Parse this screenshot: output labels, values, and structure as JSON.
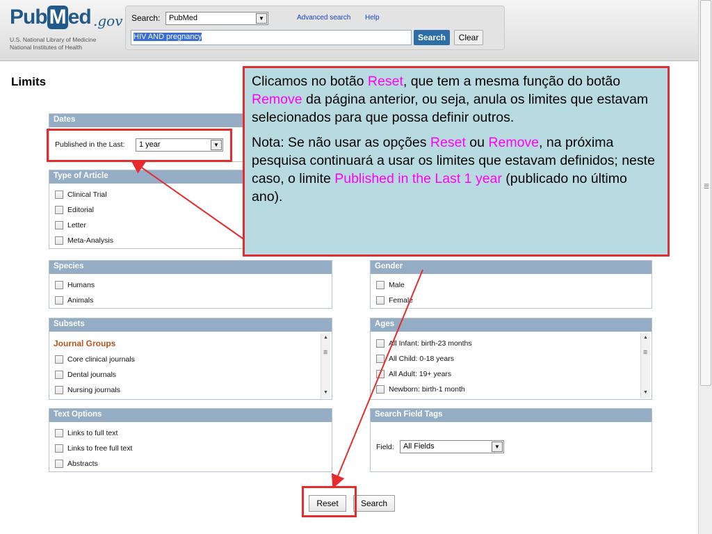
{
  "header": {
    "logo_pub": "Pub",
    "logo_m": "M",
    "logo_ed": "ed",
    "logo_gov": ".gov",
    "logo_sub1": "U.S. National Library of Medicine",
    "logo_sub2": "National Institutes of Health",
    "search_label": "Search:",
    "database": "PubMed",
    "advanced_link": "Advanced search",
    "help_link": "Help",
    "query": "HIV AND pregnancy",
    "search_button": "Search",
    "clear_button": "Clear"
  },
  "page_title": "Limits",
  "dates": {
    "heading": "Dates",
    "published_label": "Published in the Last:",
    "published_value": "1 year"
  },
  "type_of_article": {
    "heading": "Type of Article",
    "items": [
      "Clinical Trial",
      "Editorial",
      "Letter",
      "Meta-Analysis"
    ]
  },
  "species": {
    "heading": "Species",
    "items": [
      "Humans",
      "Animals"
    ]
  },
  "gender": {
    "heading": "Gender",
    "items": [
      "Male",
      "Female"
    ]
  },
  "subsets": {
    "heading": "Subsets",
    "group_title": "Journal Groups",
    "items": [
      "Core clinical journals",
      "Dental journals",
      "Nursing journals"
    ]
  },
  "ages": {
    "heading": "Ages",
    "items": [
      "All Infant: birth-23 months",
      "All Child: 0-18 years",
      "All Adult: 19+ years",
      "Newborn: birth-1 month"
    ]
  },
  "text_options": {
    "heading": "Text Options",
    "items": [
      "Links to full text",
      "Links to free full text",
      "Abstracts"
    ]
  },
  "search_field_tags": {
    "heading": "Search Field Tags",
    "field_label": "Field:",
    "field_value": "All Fields"
  },
  "bottom": {
    "reset_button": "Reset",
    "search_button": "Search"
  },
  "callout": {
    "p1_a": "Clicamos no botão ",
    "p1_reset": "Reset",
    "p1_b": ", que tem a mesma função do botão ",
    "p1_remove": "Remove",
    "p1_c": " da página anterior, ou seja, anula os limites que estavam selecionados para que possa definir outros.",
    "p2_a": "Nota: Se não usar as opções ",
    "p2_reset": "Reset",
    "p2_b": " ou ",
    "p2_remove": "Remove",
    "p2_c": ", na próxima pesquisa continuará a usar os limites que estavam definidos; neste caso, o limite ",
    "p2_limit": "Published in the Last 1 year",
    "p2_d": " (publicado no último ano)."
  },
  "colors": {
    "highlight": "#ff00ff",
    "callout_bg": "#b7dbe1",
    "annotation_red": "#e52b2b",
    "panel_header": "#94acc4",
    "brand_blue": "#215a8a"
  }
}
